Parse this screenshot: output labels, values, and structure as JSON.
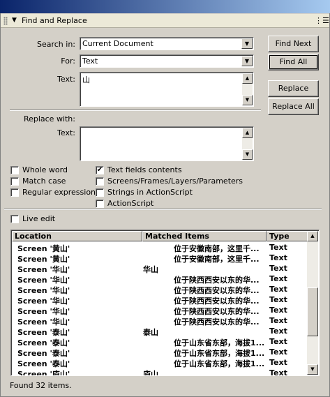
{
  "panel": {
    "title": "Find and Replace",
    "collapse_icon": "triangle-down-icon",
    "menu_icon": "options-menu-icon"
  },
  "search": {
    "search_in_label": "Search in:",
    "search_in_value": "Current Document",
    "for_label": "For:",
    "for_value": "Text",
    "text_label": "Text:",
    "text_value": "山"
  },
  "replace": {
    "label": "Replace with:",
    "text_label": "Text:",
    "text_value": ""
  },
  "buttons": {
    "find_next": "Find Next",
    "find_all": "Find All",
    "replace": "Replace",
    "replace_all": "Replace All"
  },
  "options": {
    "whole_word": {
      "label": "Whole word",
      "checked": false
    },
    "match_case": {
      "label": "Match case",
      "checked": false
    },
    "regex": {
      "label": "Regular expressions",
      "checked": false
    },
    "text_fields": {
      "label": "Text fields contents",
      "checked": true
    },
    "screens": {
      "label": "Screens/Frames/Layers/Parameters",
      "checked": false
    },
    "strings_as": {
      "label": "Strings in ActionScript",
      "checked": false
    },
    "actionscript": {
      "label": "ActionScript",
      "checked": false
    },
    "live_edit": {
      "label": "Live edit",
      "checked": false
    }
  },
  "results": {
    "columns": [
      "Location",
      "Matched Items",
      "Type"
    ],
    "rows": [
      {
        "location": "Screen '黄山'",
        "matched": "　　　　位于安徽南部，这里千...",
        "type": "Text"
      },
      {
        "location": "Screen '黄山'",
        "matched": "　　　　位于安徽南部，这里千...",
        "type": "Text"
      },
      {
        "location": "Screen '华山'",
        "matched": "华山",
        "type": "Text"
      },
      {
        "location": "Screen '华山'",
        "matched": "　　　　位于陕西西安以东的华...",
        "type": "Text"
      },
      {
        "location": "Screen '华山'",
        "matched": "　　　　位于陕西西安以东的华...",
        "type": "Text"
      },
      {
        "location": "Screen '华山'",
        "matched": "　　　　位于陕西西安以东的华...",
        "type": "Text"
      },
      {
        "location": "Screen '华山'",
        "matched": "　　　　位于陕西西安以东的华...",
        "type": "Text"
      },
      {
        "location": "Screen '华山'",
        "matched": "　　　　位于陕西西安以东的华...",
        "type": "Text"
      },
      {
        "location": "Screen '泰山'",
        "matched": "泰山",
        "type": "Text"
      },
      {
        "location": "Screen '泰山'",
        "matched": "　　　　位于山东省东部，海拔1...",
        "type": "Text"
      },
      {
        "location": "Screen '泰山'",
        "matched": "　　　　位于山东省东部，海拔1...",
        "type": "Text"
      },
      {
        "location": "Screen '泰山'",
        "matched": "　　　　位于山东省东部，海拔1...",
        "type": "Text"
      },
      {
        "location": "Screen '庐山'",
        "matched": "庐山",
        "type": "Text"
      }
    ]
  },
  "status": "Found 32 items."
}
